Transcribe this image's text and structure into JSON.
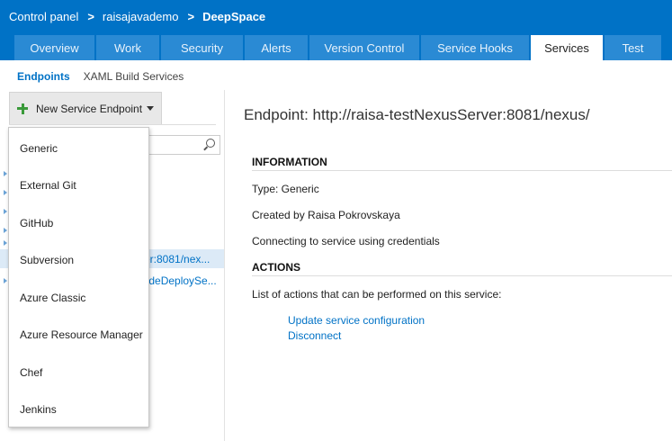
{
  "header": {
    "breadcrumb": [
      {
        "label": "Control panel"
      },
      {
        "label": "raisajavademo"
      },
      {
        "label": "DeepSpace"
      }
    ],
    "separator": ">",
    "tabs": [
      {
        "label": "Overview"
      },
      {
        "label": "Work"
      },
      {
        "label": "Security"
      },
      {
        "label": "Alerts"
      },
      {
        "label": "Version Control"
      },
      {
        "label": "Service Hooks"
      },
      {
        "label": "Services"
      },
      {
        "label": "Test"
      }
    ],
    "active_tab": "Services"
  },
  "subnav": {
    "items": [
      {
        "label": "Endpoints"
      },
      {
        "label": "XAML Build Services"
      }
    ],
    "active": "Endpoints"
  },
  "left": {
    "new_endpoint_label": "New Service Endpoint",
    "filter_icon": "search-icon",
    "list": [
      {
        "label": "rver:8081/nex..."
      },
      {
        "label": "CodeDeploySe..."
      }
    ],
    "selected_index": 0
  },
  "dropdown": {
    "items": [
      {
        "label": "Generic"
      },
      {
        "label": "External Git"
      },
      {
        "label": "GitHub"
      },
      {
        "label": "Subversion"
      },
      {
        "label": "Azure Classic"
      },
      {
        "label": "Azure Resource Manager"
      },
      {
        "label": "Chef"
      },
      {
        "label": "Jenkins"
      }
    ]
  },
  "detail": {
    "title": "Endpoint: http://raisa-testNexusServer:8081/nexus/",
    "information_header": "INFORMATION",
    "type_line": "Type: Generic",
    "created_line": "Created by Raisa Pokrovskaya",
    "connecting_line": "Connecting to service using credentials",
    "actions_header": "ACTIONS",
    "actions_description": "List of actions that can be performed on this service:",
    "actions": [
      {
        "label": "Update service configuration"
      },
      {
        "label": "Disconnect"
      }
    ]
  },
  "colors": {
    "header_bg": "#0072c6",
    "tab_bg": "#2a8ad4",
    "link": "#0072c6",
    "selected_row": "#dceaf7"
  }
}
